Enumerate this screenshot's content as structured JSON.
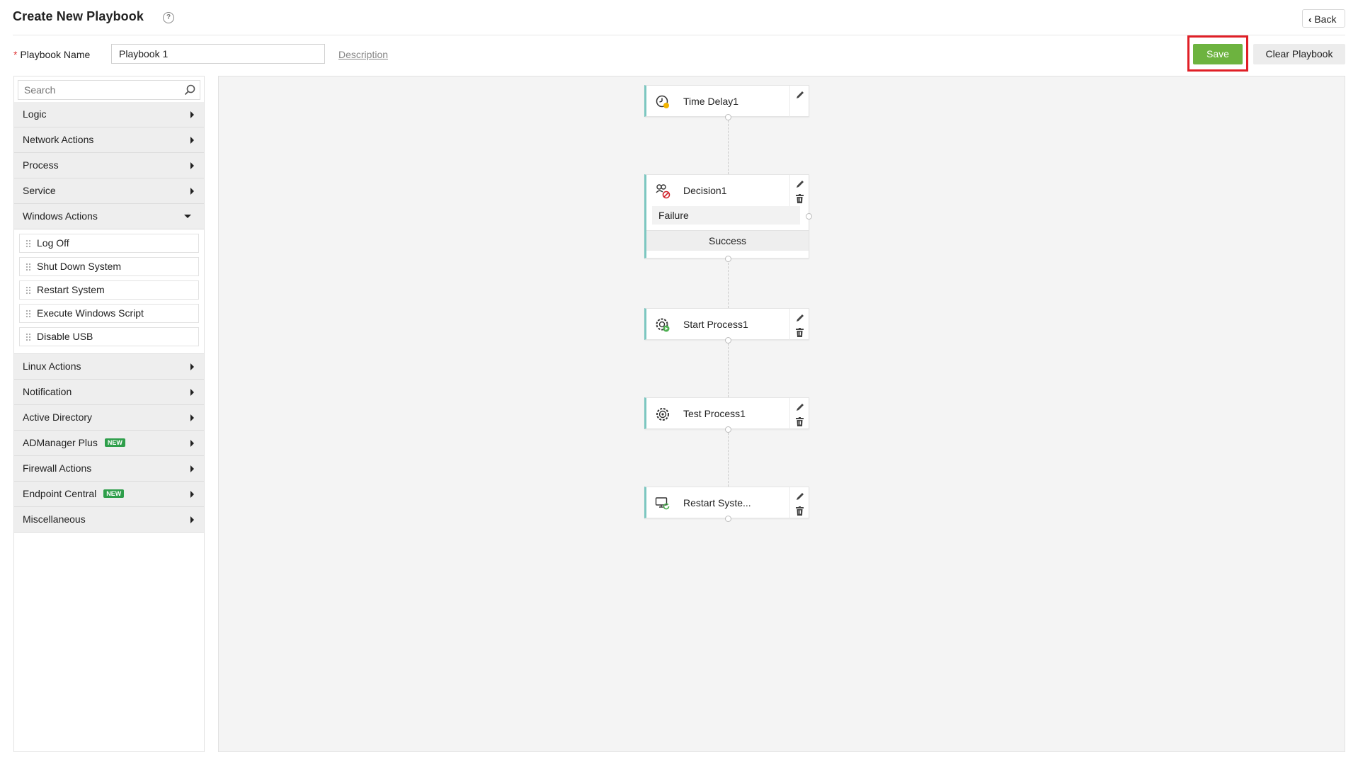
{
  "header": {
    "title": "Create New Playbook",
    "help_icon": "?",
    "back_label": "Back"
  },
  "form": {
    "name_required_mark": "*",
    "name_label": "Playbook Name",
    "name_value": "Playbook 1",
    "description_link": "Description"
  },
  "toolbar": {
    "save_label": "Save",
    "clear_label": "Clear Playbook",
    "highlight_color": "#e01f26",
    "save_color": "#6db33f"
  },
  "sidebar": {
    "search_placeholder": "Search",
    "categories": [
      {
        "label": "Logic"
      },
      {
        "label": "Network Actions"
      },
      {
        "label": "Process"
      },
      {
        "label": "Service"
      },
      {
        "label": "Windows Actions",
        "expanded": true,
        "items": [
          "Log Off",
          "Shut Down System",
          "Restart System",
          "Execute Windows Script",
          "Disable USB"
        ]
      },
      {
        "label": "Linux Actions"
      },
      {
        "label": "Notification"
      },
      {
        "label": "Active Directory"
      },
      {
        "label": "ADManager Plus",
        "badge": "NEW"
      },
      {
        "label": "Firewall Actions"
      },
      {
        "label": "Endpoint Central",
        "badge": "NEW"
      },
      {
        "label": "Miscellaneous"
      }
    ]
  },
  "canvas": {
    "nodes": [
      {
        "title": "Time Delay1",
        "icon": "clock-icon"
      },
      {
        "title": "Decision1",
        "icon": "decision-icon",
        "branches": {
          "failure": "Failure",
          "success": "Success"
        }
      },
      {
        "title": "Start Process1",
        "icon": "gear-play-icon"
      },
      {
        "title": "Test Process1",
        "icon": "gear-icon"
      },
      {
        "title": "Restart Syste...",
        "icon": "monitor-restart-icon"
      }
    ]
  }
}
